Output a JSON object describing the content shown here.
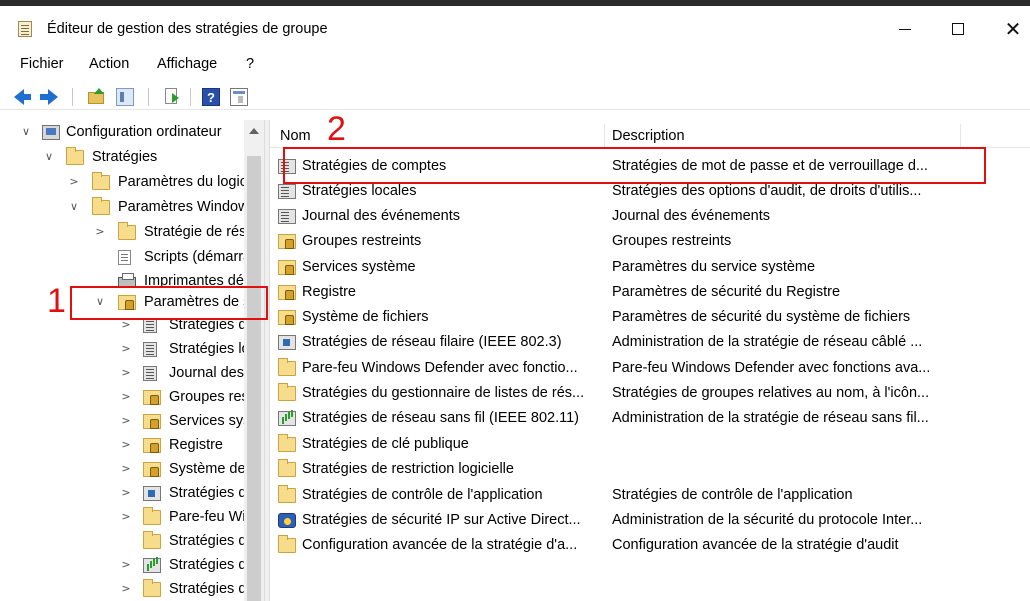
{
  "window": {
    "title": "Éditeur de gestion des stratégies de groupe",
    "minimize": "minimize",
    "maximize": "maximize",
    "close": "✕"
  },
  "menu": [
    "Fichier",
    "Action",
    "Affichage",
    "?"
  ],
  "toolbar": {
    "help_label": "?"
  },
  "tree": [
    {
      "label": "Configuration ordinateur",
      "icon": "computer-icon",
      "expand": "∨"
    },
    {
      "label": "Stratégies",
      "icon": "folder-icon",
      "expand": "∨"
    },
    {
      "label": "Paramètres du logiciel",
      "icon": "folder-icon",
      "expand": ">"
    },
    {
      "label": "Paramètres Windows",
      "icon": "folder-icon",
      "expand": "∨"
    },
    {
      "label": "Stratégie de résolution de noms",
      "icon": "folder-icon",
      "expand": ">"
    },
    {
      "label": "Scripts (démarrage/arrêt)",
      "icon": "script-icon",
      "expand": ""
    },
    {
      "label": "Imprimantes déployées",
      "icon": "printer-icon",
      "expand": ""
    },
    {
      "label": "Paramètres de sécurité",
      "icon": "security-folder-icon",
      "expand": "∨"
    },
    {
      "label": "Stratégies de comptes",
      "icon": "policy-icon",
      "expand": ">"
    },
    {
      "label": "Stratégies locales",
      "icon": "policy-icon",
      "expand": ">"
    },
    {
      "label": "Journal des événements",
      "icon": "policy-icon",
      "expand": ">"
    },
    {
      "label": "Groupes restreints",
      "icon": "security-folder-icon",
      "expand": ">"
    },
    {
      "label": "Services système",
      "icon": "security-folder-icon",
      "expand": ">"
    },
    {
      "label": "Registre",
      "icon": "security-folder-icon",
      "expand": ">"
    },
    {
      "label": "Système de fichiers",
      "icon": "security-folder-icon",
      "expand": ">"
    },
    {
      "label": "Stratégies de réseau filaire",
      "icon": "network-icon",
      "expand": ">"
    },
    {
      "label": "Pare-feu Windows Defender",
      "icon": "folder-icon",
      "expand": ">"
    },
    {
      "label": "Stratégies du gestionnaire",
      "icon": "folder-icon",
      "expand": ""
    },
    {
      "label": "Stratégies de réseau sans fil",
      "icon": "wireless-icon",
      "expand": ">"
    },
    {
      "label": "Stratégies de clé publique",
      "icon": "folder-icon",
      "expand": ">"
    }
  ],
  "columns": {
    "name": "Nom",
    "description": "Description"
  },
  "items": [
    {
      "name": "Stratégies de comptes",
      "description": "Stratégies de mot de passe et de verrouillage d...",
      "icon": "policy-icon"
    },
    {
      "name": "Stratégies locales",
      "description": "Stratégies des options d'audit, de droits d'utilis...",
      "icon": "policy-icon"
    },
    {
      "name": "Journal des événements",
      "description": "Journal des événements",
      "icon": "policy-icon"
    },
    {
      "name": "Groupes restreints",
      "description": "Groupes restreints",
      "icon": "security-folder-icon"
    },
    {
      "name": "Services système",
      "description": "Paramètres du service système",
      "icon": "security-folder-icon"
    },
    {
      "name": "Registre",
      "description": "Paramètres de sécurité du Registre",
      "icon": "security-folder-icon"
    },
    {
      "name": "Système de fichiers",
      "description": "Paramètres de sécurité du système de fichiers",
      "icon": "security-folder-icon"
    },
    {
      "name": "Stratégies de réseau filaire (IEEE 802.3)",
      "description": "Administration de la stratégie de réseau câblé ...",
      "icon": "network-icon"
    },
    {
      "name": "Pare-feu Windows Defender avec fonctio...",
      "description": "Pare-feu Windows Defender avec fonctions ava...",
      "icon": "folder-icon"
    },
    {
      "name": "Stratégies du gestionnaire de listes de rés...",
      "description": "Stratégies de groupes relatives au nom, à l'icôn...",
      "icon": "folder-icon"
    },
    {
      "name": "Stratégies de réseau sans fil (IEEE 802.11)",
      "description": "Administration de la stratégie de réseau sans fil...",
      "icon": "wireless-icon"
    },
    {
      "name": "Stratégies de clé publique",
      "description": "",
      "icon": "folder-icon"
    },
    {
      "name": "Stratégies de restriction logicielle",
      "description": "",
      "icon": "folder-icon"
    },
    {
      "name": "Stratégies de contrôle de l'application",
      "description": "Stratégies de contrôle de l'application",
      "icon": "folder-icon"
    },
    {
      "name": "Stratégies de sécurité IP sur Active Direct...",
      "description": "Administration de la sécurité du protocole Inter...",
      "icon": "ipsec-icon"
    },
    {
      "name": "Configuration avancée de la stratégie d'a...",
      "description": "Configuration avancée de la stratégie d'audit",
      "icon": "folder-icon"
    }
  ],
  "annotations": {
    "first": "1",
    "second": "2",
    "color": "#e01010"
  }
}
